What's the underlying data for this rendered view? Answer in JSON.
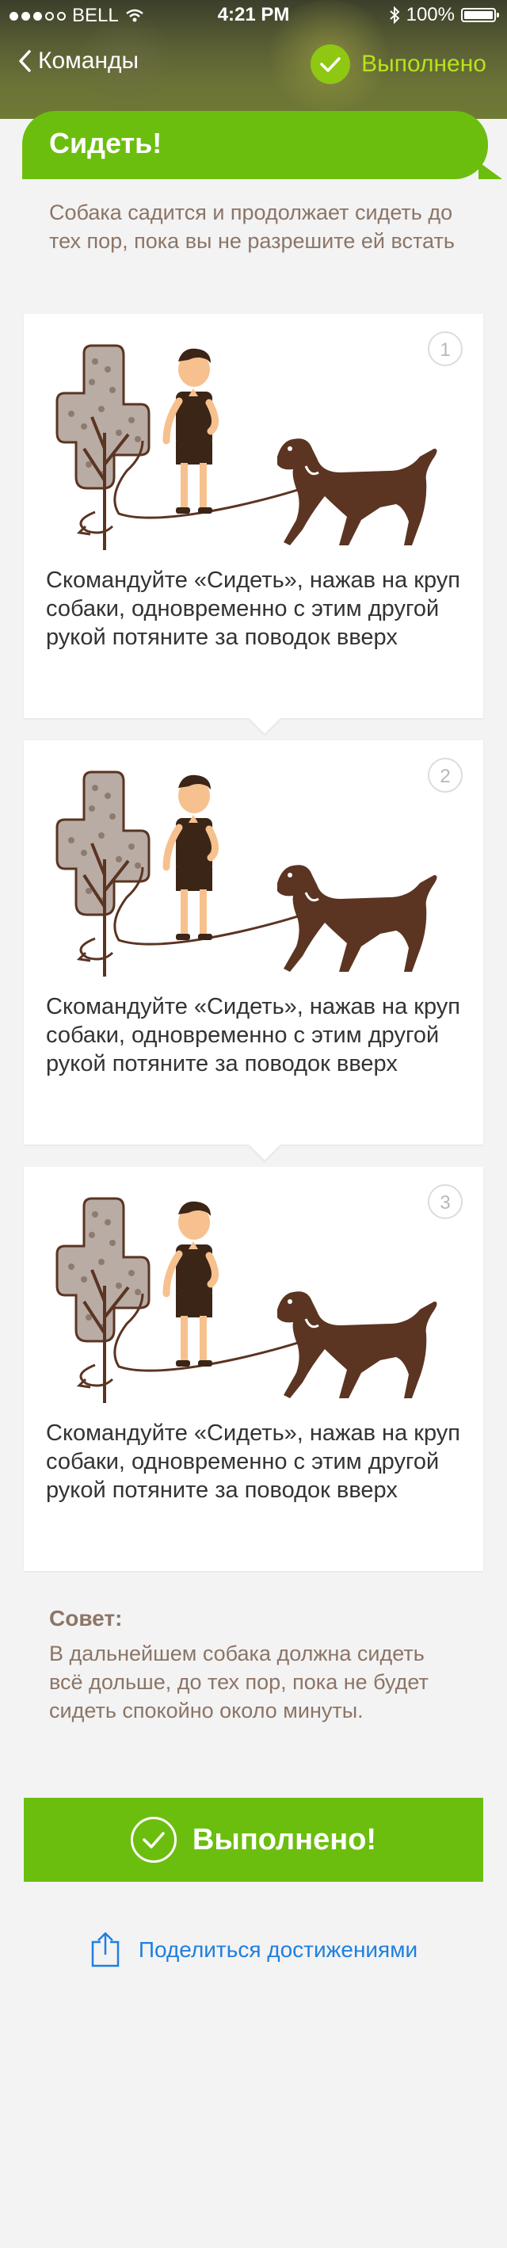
{
  "status_bar": {
    "carrier": "BELL",
    "time": "4:21 PM",
    "battery": "100%"
  },
  "nav": {
    "back_label": "Команды",
    "done_label": "Выполнено"
  },
  "title": "Сидеть!",
  "description": "Собака садится и продолжает сидеть до тех пор, пока вы не разрешите ей встать",
  "steps": [
    {
      "number": "1",
      "text": "Скомандуйте «Сидеть», нажав на круп собаки, одновременно с этим другой рукой потяните за поводок вверх"
    },
    {
      "number": "2",
      "text": "Скомандуйте «Сидеть», нажав на круп собаки, одновременно с этим другой рукой потяните за поводок вверх"
    },
    {
      "number": "3",
      "text": "Скомандуйте «Сидеть», нажав на круп собаки, одновременно с этим другой рукой потяните за поводок вверх"
    }
  ],
  "tip": {
    "label": "Совет:",
    "text": "В дальнейшем собака должна сидеть всё дольше, до тех пор, пока не будет сидеть спокойно около минуты."
  },
  "done_button": "Выполнено!",
  "share_label": "Поделиться достижениями",
  "colors": {
    "accent_green": "#6cbe0e",
    "link_blue": "#1f7fe0",
    "text_brown": "#8c7567",
    "dog_brown": "#5b3422"
  }
}
